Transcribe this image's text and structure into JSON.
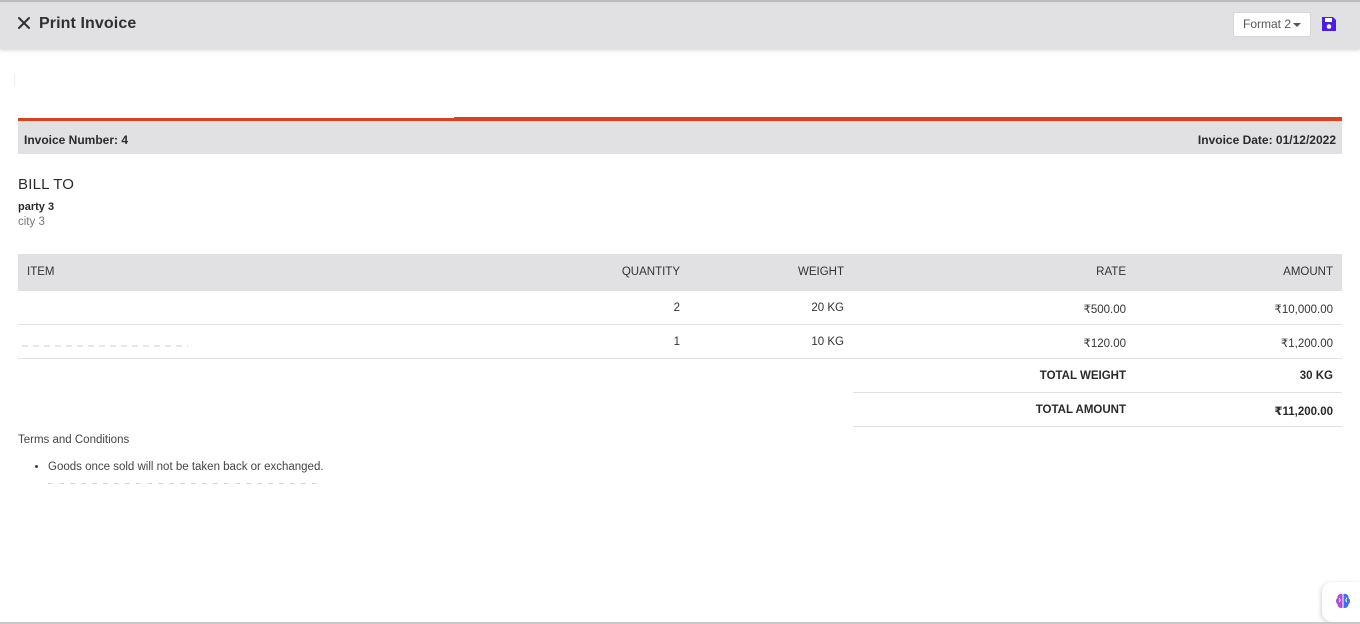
{
  "header": {
    "title": "Print Invoice",
    "format_select_value": "Format 2",
    "icons": [
      "close-icon",
      "chevron-down-icon",
      "save-icon"
    ],
    "accent_color": "#4c1de3"
  },
  "invoice": {
    "number_label": "Invoice Number: 4",
    "date_label": "Invoice Date: 01/12/2022",
    "accent_color": "#d9421b"
  },
  "bill_to": {
    "heading": "BILL TO",
    "name": "party 3",
    "city": "city 3"
  },
  "table": {
    "headers": {
      "item": "ITEM",
      "quantity": "QUANTITY",
      "weight": "WEIGHT",
      "rate": "RATE",
      "amount": "AMOUNT"
    },
    "rows": [
      {
        "item": "",
        "quantity": "2",
        "weight": "20 KG",
        "rate": "₹500.00",
        "amount": "₹10,000.00"
      },
      {
        "item": "",
        "quantity": "1",
        "weight": "10 KG",
        "rate": "₹120.00",
        "amount": "₹1,200.00"
      }
    ],
    "totals": [
      {
        "label": "TOTAL WEIGHT",
        "value": "30 KG"
      },
      {
        "label": "TOTAL AMOUNT",
        "value": "₹11,200.00"
      }
    ]
  },
  "terms": {
    "heading": "Terms and Conditions",
    "items": [
      "Goods once sold will not be taken back or exchanged.",
      ""
    ]
  },
  "assistant": {
    "icon": "brain-icon"
  }
}
